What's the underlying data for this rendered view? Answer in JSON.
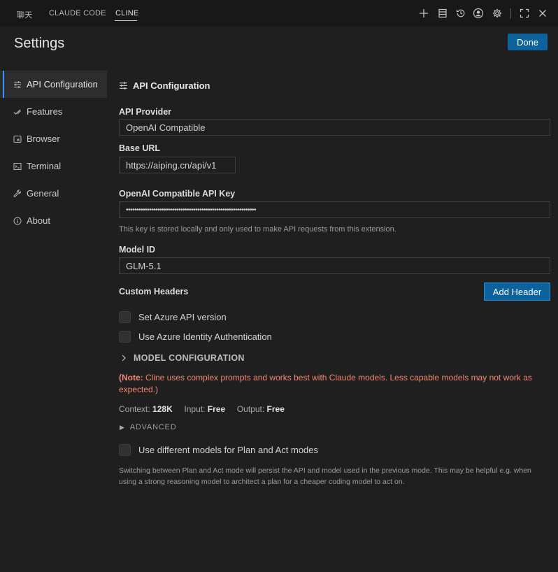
{
  "tabs": [
    {
      "label": "聊天"
    },
    {
      "label": "CLAUDE CODE"
    },
    {
      "label": "CLINE",
      "active": true
    }
  ],
  "toolbar_icons": [
    "plus-icon",
    "history-list-icon",
    "history-icon",
    "account-icon",
    "settings-icon",
    "maximize-icon",
    "close-icon"
  ],
  "page": {
    "title": "Settings",
    "done_label": "Done"
  },
  "sidebar": {
    "items": [
      {
        "label": "API Configuration",
        "icon": "sliders-icon",
        "active": true
      },
      {
        "label": "Features",
        "icon": "check-icon"
      },
      {
        "label": "Browser",
        "icon": "browser-icon"
      },
      {
        "label": "Terminal",
        "icon": "terminal-icon"
      },
      {
        "label": "General",
        "icon": "wrench-icon"
      },
      {
        "label": "About",
        "icon": "info-icon"
      }
    ]
  },
  "api_config": {
    "heading": "API Configuration",
    "provider_label": "API Provider",
    "provider_value": "OpenAI Compatible",
    "base_url_label": "Base URL",
    "base_url_value": "https://aiping.cn/api/v1",
    "api_key_label": "OpenAI Compatible API Key",
    "api_key_value": "••••••••••••••••••••••••••••••••••••••••••••••••••••••••••••••",
    "api_key_hint": "This key is stored locally and only used to make API requests from this extension.",
    "model_id_label": "Model ID",
    "model_id_value": "GLM-5.1",
    "custom_headers_label": "Custom Headers",
    "add_header_label": "Add Header",
    "azure_version_label": "Set Azure API version",
    "azure_identity_label": "Use Azure Identity Authentication",
    "model_config_label": "MODEL CONFIGURATION",
    "note_prefix": "(Note:",
    "note_text": " Cline uses complex prompts and works best with Claude models. Less capable models may not work as expected.)",
    "context_label": "Context:",
    "context_value": "128K",
    "input_label": "Input:",
    "input_value": "Free",
    "output_label": "Output:",
    "output_value": "Free",
    "advanced_label": "ADVANCED",
    "plan_act_label": "Use different models for Plan and Act modes",
    "plan_act_hint": "Switching between Plan and Act mode will persist the API and model used in the previous mode. This may be helpful e.g. when using a strong reasoning model to architect a plan for a cheaper coding model to act on."
  },
  "colors": {
    "background": "#1f1f1f",
    "accent_button": "#0e639c",
    "active_indicator": "#3794ff",
    "note": "#f48771"
  }
}
